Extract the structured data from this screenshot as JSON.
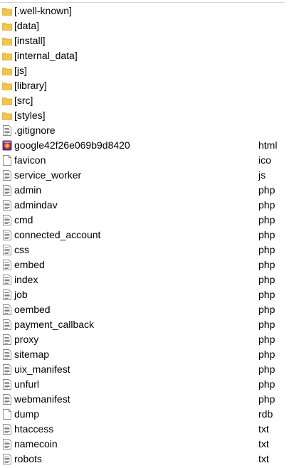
{
  "colors": {
    "folder": "#f3c64b",
    "folder_dark": "#d9a93a",
    "text_file_lines": "#7a7a7a",
    "hover": "#e5f3ff"
  },
  "files": [
    {
      "name": "[.well-known]",
      "ext": "",
      "icon": "folder-icon"
    },
    {
      "name": "[data]",
      "ext": "",
      "icon": "folder-icon"
    },
    {
      "name": "[install]",
      "ext": "",
      "icon": "folder-icon"
    },
    {
      "name": "[internal_data]",
      "ext": "",
      "icon": "folder-icon"
    },
    {
      "name": "[js]",
      "ext": "",
      "icon": "folder-icon"
    },
    {
      "name": "[library]",
      "ext": "",
      "icon": "folder-icon"
    },
    {
      "name": "[src]",
      "ext": "",
      "icon": "folder-icon"
    },
    {
      "name": "[styles]",
      "ext": "",
      "icon": "folder-icon"
    },
    {
      "name": ".gitignore",
      "ext": "",
      "icon": "text-file-icon"
    },
    {
      "name": "google42f26e069b9d8420",
      "ext": "html",
      "icon": "browser-file-icon"
    },
    {
      "name": "favicon",
      "ext": "ico",
      "icon": "blank-file-icon"
    },
    {
      "name": "service_worker",
      "ext": "js",
      "icon": "text-file-icon"
    },
    {
      "name": "admin",
      "ext": "php",
      "icon": "text-file-icon"
    },
    {
      "name": "admindav",
      "ext": "php",
      "icon": "text-file-icon"
    },
    {
      "name": "cmd",
      "ext": "php",
      "icon": "text-file-icon"
    },
    {
      "name": "connected_account",
      "ext": "php",
      "icon": "text-file-icon"
    },
    {
      "name": "css",
      "ext": "php",
      "icon": "text-file-icon"
    },
    {
      "name": "embed",
      "ext": "php",
      "icon": "text-file-icon"
    },
    {
      "name": "index",
      "ext": "php",
      "icon": "text-file-icon"
    },
    {
      "name": "job",
      "ext": "php",
      "icon": "text-file-icon"
    },
    {
      "name": "oembed",
      "ext": "php",
      "icon": "text-file-icon"
    },
    {
      "name": "payment_callback",
      "ext": "php",
      "icon": "text-file-icon"
    },
    {
      "name": "proxy",
      "ext": "php",
      "icon": "text-file-icon"
    },
    {
      "name": "sitemap",
      "ext": "php",
      "icon": "text-file-icon"
    },
    {
      "name": "uix_manifest",
      "ext": "php",
      "icon": "text-file-icon"
    },
    {
      "name": "unfurl",
      "ext": "php",
      "icon": "text-file-icon"
    },
    {
      "name": "webmanifest",
      "ext": "php",
      "icon": "text-file-icon"
    },
    {
      "name": "dump",
      "ext": "rdb",
      "icon": "blank-file-icon"
    },
    {
      "name": "htaccess",
      "ext": "txt",
      "icon": "text-file-icon"
    },
    {
      "name": "namecoin",
      "ext": "txt",
      "icon": "text-file-icon"
    },
    {
      "name": "robots",
      "ext": "txt",
      "icon": "text-file-icon"
    }
  ]
}
